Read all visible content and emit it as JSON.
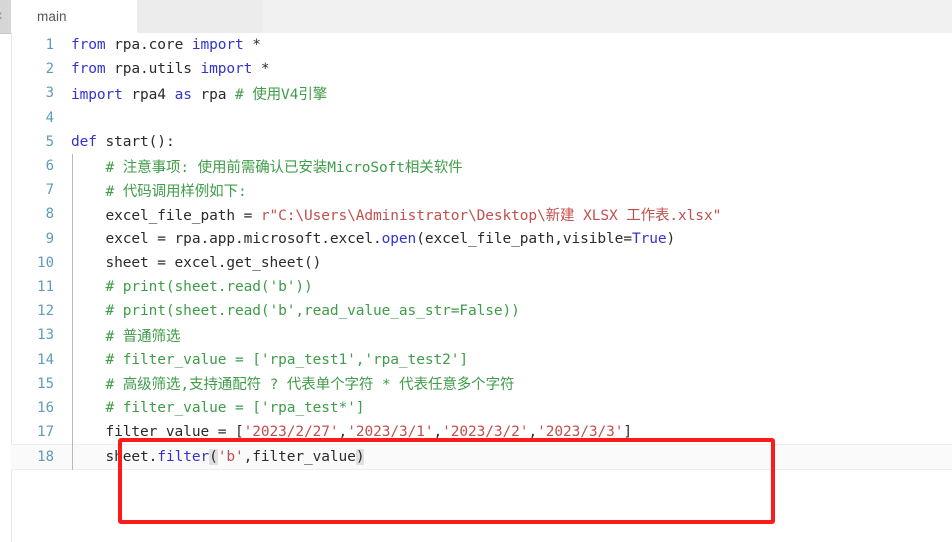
{
  "window": {
    "rail_glyph": "x"
  },
  "tabbar": {
    "tabs": [
      {
        "label": "main",
        "active": true
      }
    ]
  },
  "editor": {
    "language": "python",
    "current_line": 18,
    "colors": {
      "keyword": "#3434cc",
      "comment": "#3f9c48",
      "string": "#c2504d",
      "function": "#3434cc",
      "text": "#2b2b2b",
      "line_number": "#5e9cb8",
      "annotation_box": "#fb1b1b",
      "tab_active_bg": "#ffffff",
      "tab_bar_bg": "#f1f1f1",
      "current_line_bg": "#fafafa",
      "bracket_match_bg": "#e0e0e0"
    },
    "lines": [
      {
        "n": "1",
        "tokens": [
          {
            "t": "from ",
            "c": "kw"
          },
          {
            "t": "rpa.core ",
            "c": "plain"
          },
          {
            "t": "import",
            "c": "kw"
          },
          {
            "t": " *",
            "c": "plain"
          }
        ]
      },
      {
        "n": "2",
        "tokens": [
          {
            "t": "from ",
            "c": "kw"
          },
          {
            "t": "rpa.utils ",
            "c": "plain"
          },
          {
            "t": "import",
            "c": "kw"
          },
          {
            "t": " *",
            "c": "plain"
          }
        ]
      },
      {
        "n": "3",
        "tokens": [
          {
            "t": "import ",
            "c": "kw"
          },
          {
            "t": "rpa4 ",
            "c": "plain"
          },
          {
            "t": "as",
            "c": "kw"
          },
          {
            "t": " rpa ",
            "c": "plain"
          },
          {
            "t": "# 使用V4引擎",
            "c": "cm"
          }
        ]
      },
      {
        "n": "4",
        "tokens": []
      },
      {
        "n": "5",
        "tokens": [
          {
            "t": "def ",
            "c": "kw"
          },
          {
            "t": "start():",
            "c": "plain"
          }
        ]
      },
      {
        "n": "6",
        "tokens": [
          {
            "t": "    # 注意事项: 使用前需确认已安装MicroSoft相关软件",
            "c": "cm"
          }
        ]
      },
      {
        "n": "7",
        "tokens": [
          {
            "t": "    # 代码调用样例如下:",
            "c": "cm"
          }
        ]
      },
      {
        "n": "8",
        "tokens": [
          {
            "t": "    excel_file_path = ",
            "c": "plain"
          },
          {
            "t": "r\"C:\\Users\\Administrator\\Desktop\\新建 XLSX 工作表.xlsx\"",
            "c": "str"
          }
        ]
      },
      {
        "n": "9",
        "tokens": [
          {
            "t": "    excel = rpa.app.microsoft.excel.",
            "c": "plain"
          },
          {
            "t": "open",
            "c": "fn"
          },
          {
            "t": "(excel_file_path,visible=",
            "c": "plain"
          },
          {
            "t": "True",
            "c": "kw"
          },
          {
            "t": ")",
            "c": "plain"
          }
        ]
      },
      {
        "n": "10",
        "tokens": [
          {
            "t": "    sheet = excel.get_sheet()",
            "c": "plain"
          }
        ]
      },
      {
        "n": "11",
        "tokens": [
          {
            "t": "    # print(sheet.read('b'))",
            "c": "cm"
          }
        ]
      },
      {
        "n": "12",
        "tokens": [
          {
            "t": "    # print(sheet.read('b',read_value_as_str=False))",
            "c": "cm"
          }
        ]
      },
      {
        "n": "13",
        "tokens": [
          {
            "t": "    # 普通筛选",
            "c": "cm"
          }
        ]
      },
      {
        "n": "14",
        "tokens": [
          {
            "t": "    # filter_value = ['rpa_test1','rpa_test2']",
            "c": "cm"
          }
        ]
      },
      {
        "n": "15",
        "tokens": [
          {
            "t": "    # 高级筛选,支持通配符 ? 代表单个字符 * 代表任意多个字符",
            "c": "cm"
          }
        ]
      },
      {
        "n": "16",
        "tokens": [
          {
            "t": "    # filter_value = ['rpa_test*']",
            "c": "cm"
          }
        ]
      },
      {
        "n": "17",
        "tokens": [
          {
            "t": "    filter_value = [",
            "c": "plain"
          },
          {
            "t": "'2023/2/27'",
            "c": "str"
          },
          {
            "t": ",",
            "c": "plain"
          },
          {
            "t": "'2023/3/1'",
            "c": "str"
          },
          {
            "t": ",",
            "c": "plain"
          },
          {
            "t": "'2023/3/2'",
            "c": "str"
          },
          {
            "t": ",",
            "c": "plain"
          },
          {
            "t": "'2023/3/3'",
            "c": "str"
          },
          {
            "t": "]",
            "c": "plain"
          }
        ]
      },
      {
        "n": "18",
        "current": true,
        "tokens": [
          {
            "t": "    sheet.",
            "c": "plain"
          },
          {
            "t": "filter",
            "c": "fn"
          },
          {
            "t": "(",
            "c": "plain",
            "hl": true
          },
          {
            "t": "'b'",
            "c": "str"
          },
          {
            "t": ",filter_value",
            "c": "plain"
          },
          {
            "t": ")",
            "c": "plain",
            "hl": true
          }
        ]
      }
    ]
  },
  "annotation": {
    "type": "rectangle-highlight",
    "covers_lines": "17-18",
    "color": "#fb1b1b"
  }
}
